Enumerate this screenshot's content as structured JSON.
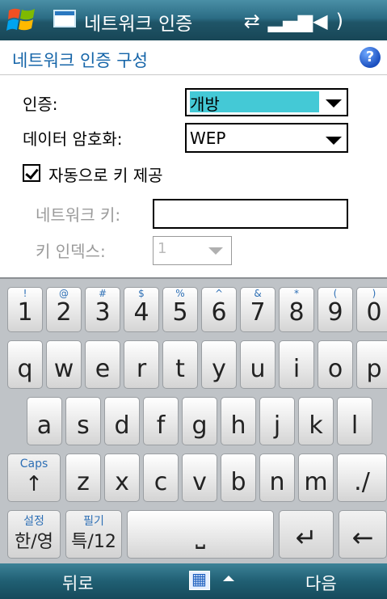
{
  "titlebar": {
    "app_title": "네트워크 인증",
    "status_icons": "⇄ ▂▄▆ ◀("
  },
  "header": {
    "title": "네트워크 인증 구성",
    "help_label": "?"
  },
  "form": {
    "auth_label": "인증:",
    "auth_value": "개방",
    "encryption_label": "데이터 암호화:",
    "encryption_value": "WEP",
    "auto_key_label": "자동으로 키 제공",
    "auto_key_checked": true,
    "network_key_label": "네트워크 키:",
    "network_key_value": "",
    "key_index_label": "키 인덱스:",
    "key_index_value": "1"
  },
  "keyboard": {
    "row1": [
      {
        "main": "1",
        "sup": "!"
      },
      {
        "main": "2",
        "sup": "@"
      },
      {
        "main": "3",
        "sup": "#"
      },
      {
        "main": "4",
        "sup": "$"
      },
      {
        "main": "5",
        "sup": "%"
      },
      {
        "main": "6",
        "sup": "^"
      },
      {
        "main": "7",
        "sup": "&"
      },
      {
        "main": "8",
        "sup": "*"
      },
      {
        "main": "9",
        "sup": "("
      },
      {
        "main": "0",
        "sup": ")"
      }
    ],
    "row2": [
      "q",
      "w",
      "e",
      "r",
      "t",
      "y",
      "u",
      "i",
      "o",
      "p"
    ],
    "row3": [
      "a",
      "s",
      "d",
      "f",
      "g",
      "h",
      "j",
      "k",
      "l"
    ],
    "row4": [
      "z",
      "x",
      "c",
      "v",
      "b",
      "n",
      "m",
      "./"
    ],
    "caps_label": "Caps",
    "caps_arrow": "↑",
    "lang_top": "설정",
    "lang_main": "한/영",
    "sym_top": "필기",
    "sym_main": "특/12",
    "space_glyph": "⎵",
    "enter_glyph": "↵",
    "backspace_glyph": "←"
  },
  "softkeys": {
    "left": "뒤로",
    "right": "다음"
  }
}
